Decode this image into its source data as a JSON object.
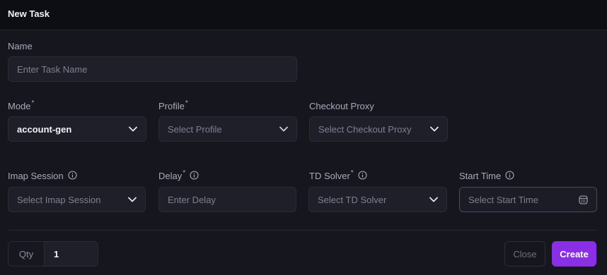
{
  "header": {
    "title": "New Task"
  },
  "form": {
    "name": {
      "label": "Name",
      "placeholder": "Enter Task Name"
    },
    "mode": {
      "label": "Mode",
      "required": "*",
      "value": "account-gen"
    },
    "profile": {
      "label": "Profile",
      "required": "*",
      "placeholder": "Select Profile"
    },
    "checkout_proxy": {
      "label": "Checkout Proxy",
      "placeholder": "Select Checkout Proxy"
    },
    "imap_session": {
      "label": "Imap Session",
      "placeholder": "Select Imap Session"
    },
    "delay": {
      "label": "Delay",
      "required": "*",
      "placeholder": "Enter Delay"
    },
    "td_solver": {
      "label": "TD Solver",
      "required": "*",
      "placeholder": "Select TD Solver"
    },
    "start_time": {
      "label": "Start Time",
      "placeholder": "Select Start Time"
    }
  },
  "footer": {
    "qty_label": "Qty",
    "qty_value": "1",
    "close_label": "Close",
    "create_label": "Create"
  },
  "icons": {
    "info": "info-circle-icon",
    "chevron": "chevron-down-icon",
    "calendar": "calendar-icon"
  },
  "colors": {
    "accent": "#8b2fe6",
    "background": "#16161f",
    "header_background": "#0d0d14",
    "field_background": "#1f1f2a"
  }
}
